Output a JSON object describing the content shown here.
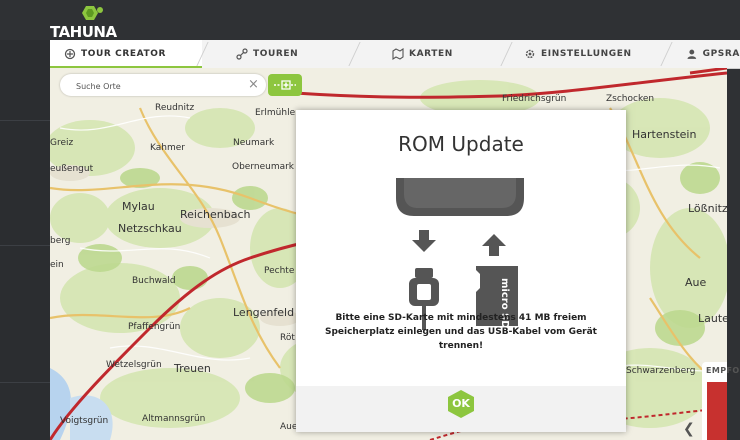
{
  "app": {
    "logo_text": "TAHUNA"
  },
  "tabs": [
    {
      "label": "TOUR CREATOR",
      "icon": "tour-creator-icon",
      "active": true
    },
    {
      "label": "TOUREN",
      "icon": "route-icon"
    },
    {
      "label": "KARTEN",
      "icon": "map-icon"
    },
    {
      "label": "EINSTELLUNGEN",
      "icon": "gear-icon"
    },
    {
      "label": "GPSRA",
      "icon": "user-icon"
    }
  ],
  "search": {
    "placeholder": "Suche Orte",
    "clear": "×"
  },
  "map": {
    "towns": [
      {
        "name": "Reudnitz"
      },
      {
        "name": "Greiz"
      },
      {
        "name": "Kahmer"
      },
      {
        "name": "Neumark"
      },
      {
        "name": "Erlmühle"
      },
      {
        "name": "Oberneumark"
      },
      {
        "name": "eußengut"
      },
      {
        "name": "Mylau"
      },
      {
        "name": "Reichenbach"
      },
      {
        "name": "Netzschkau"
      },
      {
        "name": "Buchwald"
      },
      {
        "name": "Lengenfeld"
      },
      {
        "name": "Pfaffengrün"
      },
      {
        "name": "Wetzelsgrün"
      },
      {
        "name": "Treuen"
      },
      {
        "name": "Voigtsgrün"
      },
      {
        "name": "Altmannsgrün"
      },
      {
        "name": "Friedrichsgrün"
      },
      {
        "name": "Zschocken"
      },
      {
        "name": "Hartenstein"
      },
      {
        "name": "Lößnitz"
      },
      {
        "name": "Aue"
      },
      {
        "name": "Lauter"
      },
      {
        "name": "Schwarzenberg"
      },
      {
        "name": "Pechte"
      },
      {
        "name": "Röt"
      },
      {
        "name": "berg"
      },
      {
        "name": "ein"
      },
      {
        "name": "Aue"
      }
    ]
  },
  "dialog": {
    "title": "ROM Update",
    "message_line1": "Bitte eine SD-Karte mit mindestens 41 MB freiem",
    "message_line2": "Speicherplatz einlegen und das USB-Kabel vom Gerät trennen!",
    "sd_card_text": "micro SD",
    "ok_label": "OK"
  },
  "side_panel": {
    "label": "EMPFO",
    "chevron": "❮"
  },
  "colors": {
    "accent": "#8dc63f",
    "topbar": "#2f3134",
    "route": "#c0282d",
    "dialog_bg": "#ffffff"
  }
}
